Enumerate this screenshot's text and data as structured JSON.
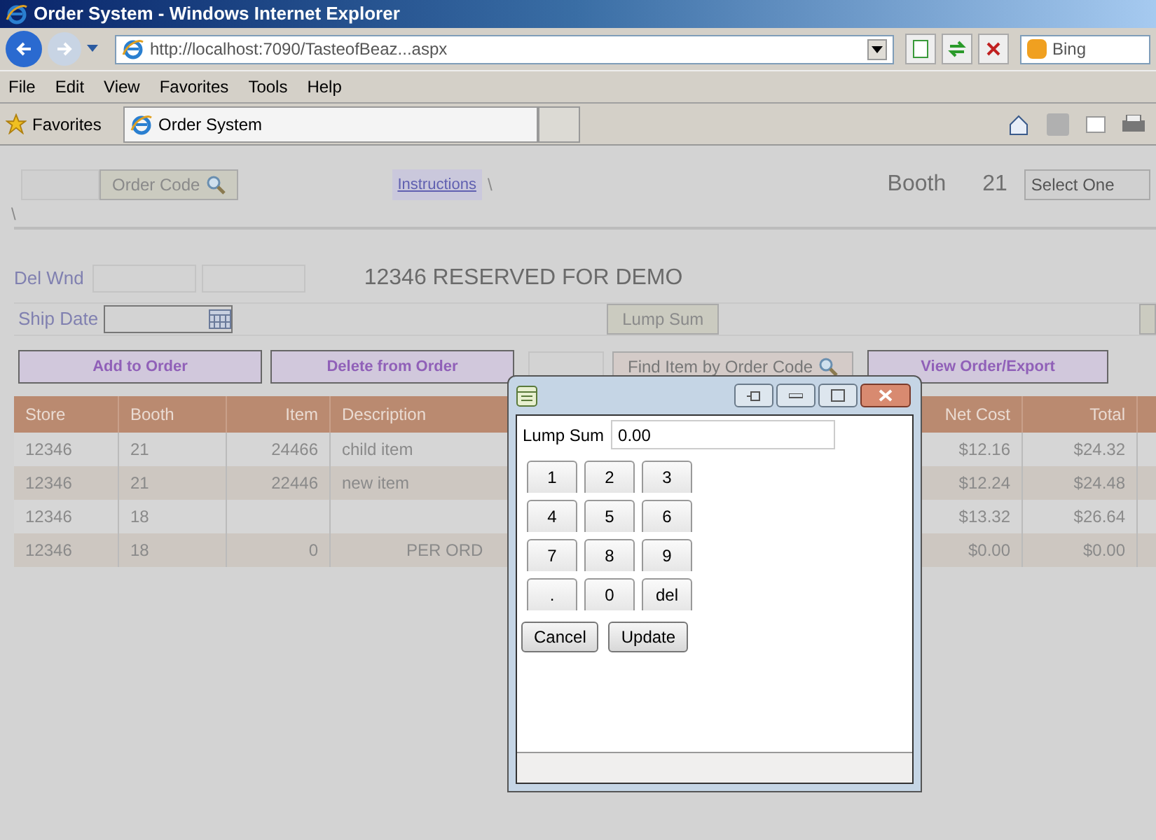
{
  "window": {
    "title": "Order System - Windows Internet Explorer"
  },
  "address_bar": {
    "url": "http://localhost:7090/TasteofBeaz...aspx",
    "search_placeholder": "Bing"
  },
  "menu": [
    "File",
    "Edit",
    "View",
    "Favorites",
    "Tools",
    "Help"
  ],
  "favorites_bar": {
    "label": "Favorites",
    "tabs": [
      {
        "label": "Order System",
        "selected": true
      },
      {
        "selected": false
      }
    ]
  },
  "page": {
    "order_code_button": "Order Code",
    "instructions_link": "Instructions",
    "separator": "\\",
    "booth_label": "Booth",
    "booth_value": "21",
    "booth_select": "Select One",
    "separator_2": "\\",
    "del_wnd_label": "Del Wnd",
    "store_title": "12346 RESERVED FOR DEMO",
    "ship_date_label": "Ship Date",
    "lump_sum_button": "Lump Sum",
    "actions": [
      "Add to Order",
      "Delete from Order"
    ],
    "find_button": "Find Item by Order Code",
    "view_button": "View Order/Export"
  },
  "table": {
    "columns": [
      "Store",
      "Booth",
      "Item",
      "Description",
      "Net Cost",
      "Total"
    ],
    "rows": [
      {
        "store": "12346",
        "booth": "21",
        "item": "24466",
        "description": "child item",
        "net_cost": "$12.16",
        "total": "$24.32"
      },
      {
        "store": "12346",
        "booth": "21",
        "item": "22446",
        "description": "new item",
        "net_cost": "$12.24",
        "total": "$24.48"
      },
      {
        "store": "12346",
        "booth": "18",
        "net_cost": "$13.32",
        "total": "$26.64"
      },
      {
        "store": "12346",
        "booth": "18",
        "item": "0",
        "description": "PER ORD",
        "net_cost": "$0.00",
        "total": "$0.00"
      }
    ]
  },
  "dialog": {
    "field_label": "Lump Sum",
    "field_value": "0.00",
    "keys": [
      "1",
      "2",
      "3",
      "4",
      "5",
      "6",
      "7",
      "8",
      "9",
      ".",
      "0",
      "del"
    ],
    "buttons": [
      "Cancel",
      "Update"
    ]
  }
}
